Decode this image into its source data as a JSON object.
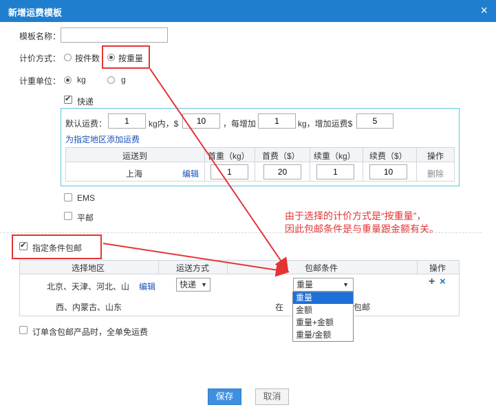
{
  "dialog": {
    "title": "新增运费模板",
    "close_symbol": "×"
  },
  "form": {
    "template_name_label": "模板名称：",
    "template_name_value": "",
    "pricing_label": "计价方式：",
    "pricing_options": [
      "按件数",
      "按重量"
    ],
    "pricing_selected": "按重量",
    "unit_label": "计重单位：",
    "unit_options": [
      "kg",
      "g"
    ],
    "unit_selected": "kg"
  },
  "express": {
    "label": "快递",
    "checked": true,
    "default_prefix": "默认运费：",
    "first_weight": "1",
    "kg_within": "kg内，$",
    "first_fee": "10",
    "each_add": "，每增加",
    "add_weight": "1",
    "kg_add_fee": "kg，增加运费$",
    "add_fee": "5",
    "add_region_link": "为指定地区添加运费",
    "table_headers": [
      "运送到",
      "首重（kg）",
      "首费（$）",
      "续重（kg）",
      "续费（$）",
      "操作"
    ],
    "rows": [
      {
        "region": "上海",
        "edit": "编辑",
        "first_weight": "1",
        "first_fee": "20",
        "add_weight": "1",
        "add_fee": "10",
        "delete": "删除"
      }
    ]
  },
  "ems": {
    "label": "EMS",
    "checked": false
  },
  "surface": {
    "label": "平邮",
    "checked": false
  },
  "free_shipping": {
    "label": "指定条件包邮",
    "checked": true,
    "headers": [
      "选择地区",
      "运送方式",
      "包邮条件",
      "操作"
    ],
    "row": {
      "regions_line1": "北京、天津、河北、山",
      "edit": "编辑",
      "regions_line2": "西、内蒙古、山东",
      "method": "快递",
      "condition_selected": "重量",
      "condition_prefix": "在",
      "condition_suffix": "包邮",
      "add_symbol": "+",
      "remove_symbol": "×"
    },
    "condition_options": [
      "重量",
      "金额",
      "重量+金额",
      "重量/金额"
    ],
    "highlighted_option": "重量"
  },
  "order_free": {
    "label": "订单含包邮产品时，全单免运费",
    "checked": false
  },
  "annotation": {
    "line1": "由于选择的计价方式是“按重量”，",
    "line2": "因此包邮条件是与重量跟金额有关。"
  },
  "buttons": {
    "save": "保存",
    "cancel": "取消"
  },
  "colors": {
    "titlebar": "#1f7fce",
    "accent_box": "#5cc3e0",
    "annotation": "#e53333",
    "save_button": "#3f8fe0",
    "link": "#1a4fb8"
  }
}
